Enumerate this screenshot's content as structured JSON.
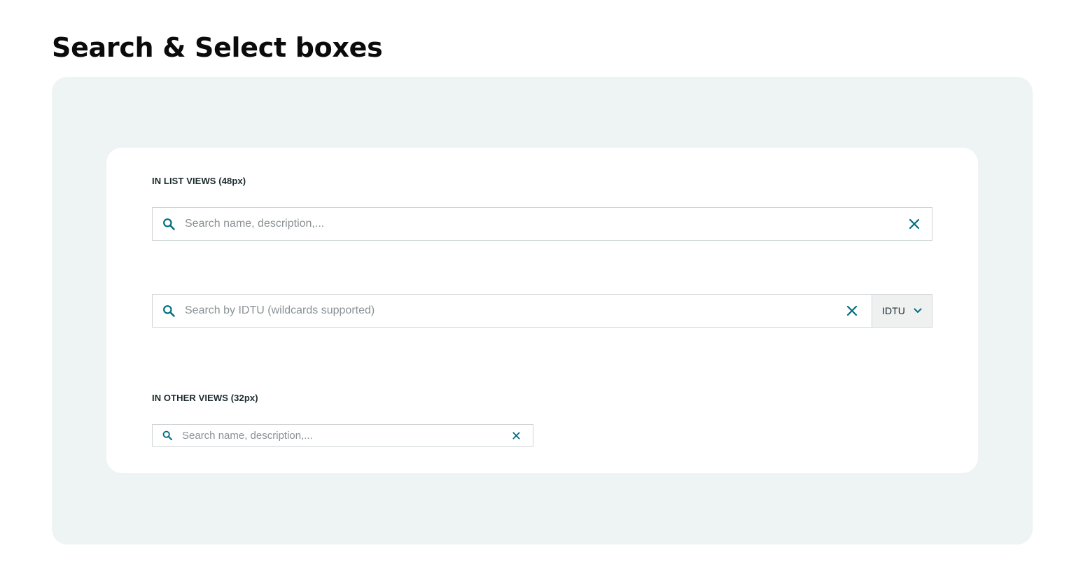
{
  "page": {
    "title": "Search & Select boxes"
  },
  "colors": {
    "accent": "#006e7f",
    "panel_bg": "#eef3f3",
    "select_bg": "#eff1f1",
    "border": "#cfd4d6"
  },
  "list_views": {
    "label": "IN LIST VIEWS (48px)",
    "search_basic": {
      "placeholder": "Search name, description,...",
      "value": "",
      "icon": "search-icon",
      "clear_icon": "close-icon"
    },
    "search_select": {
      "placeholder": "Search by IDTU (wildcards supported)",
      "value": "",
      "icon": "search-icon",
      "clear_icon": "close-icon",
      "select_value": "IDTU",
      "select_icon": "chevron-down-icon"
    }
  },
  "other_views": {
    "label": "IN OTHER VIEWS (32px)",
    "search_small": {
      "placeholder": "Search name, description,...",
      "value": "",
      "icon": "search-icon",
      "clear_icon": "close-icon"
    }
  }
}
